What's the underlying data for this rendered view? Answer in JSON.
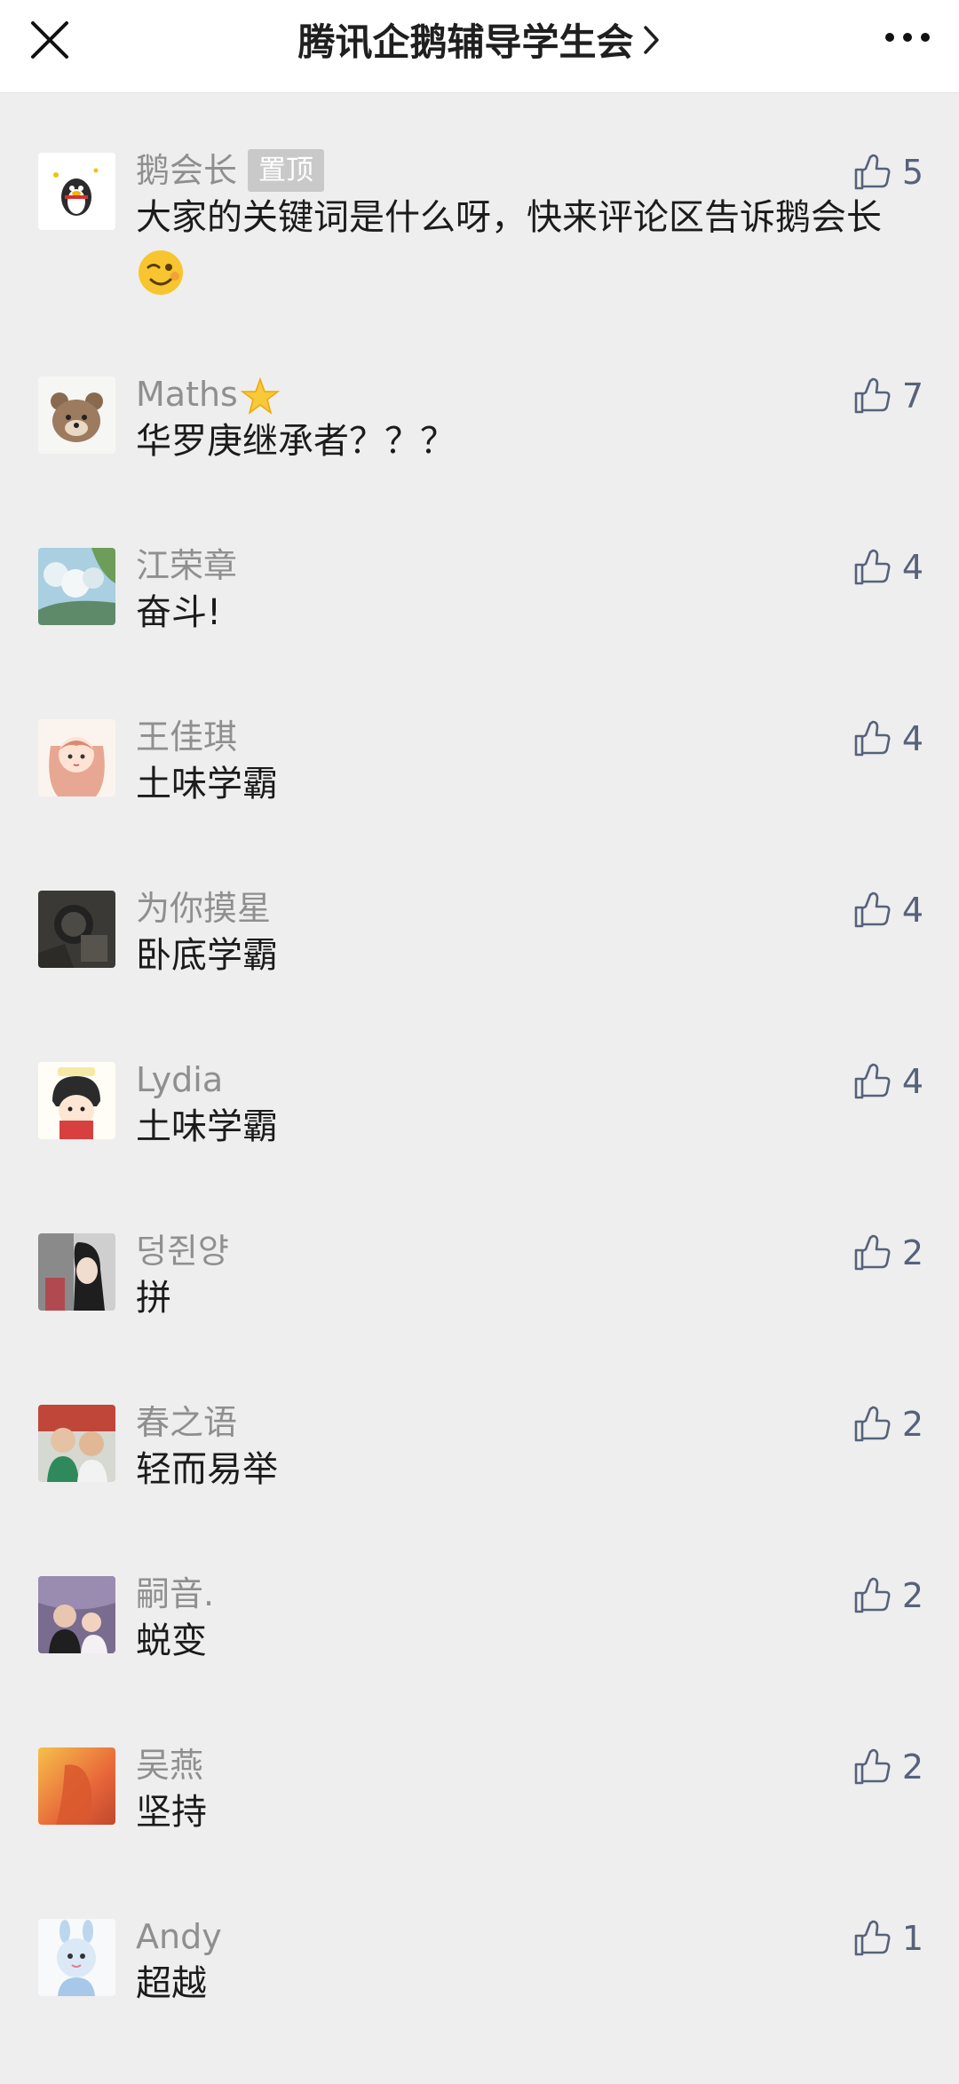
{
  "header": {
    "title": "腾讯企鹅辅导学生会",
    "close_icon": "close-icon",
    "more_icon": "more-icon"
  },
  "comments": [
    {
      "name": "鹅会长",
      "pinned_label": "置顶",
      "text": "大家的关键词是什么呀，快来评论区告诉鹅会长",
      "likes": "5"
    },
    {
      "name": "Maths",
      "text": "华罗庚继承者？？？",
      "likes": "7"
    },
    {
      "name": "江荣章",
      "text": "奋斗!",
      "likes": "4"
    },
    {
      "name": "王佳琪",
      "text": "土味学霸",
      "likes": "4"
    },
    {
      "name": "为你摸星",
      "text": "卧底学霸",
      "likes": "4"
    },
    {
      "name": "Lydia",
      "text": "土味学霸",
      "likes": "4"
    },
    {
      "name": "덩쥔양",
      "text": "拼",
      "likes": "2"
    },
    {
      "name": "春之语",
      "text": "轻而易举",
      "likes": "2"
    },
    {
      "name": "嗣音.",
      "text": "蜕变",
      "likes": "2"
    },
    {
      "name": "吴燕",
      "text": "坚持",
      "likes": "2"
    },
    {
      "name": "Andy",
      "text": "超越",
      "likes": "1"
    }
  ],
  "colors": {
    "background": "#eeeeee",
    "name": "#8f8f8f",
    "like": "#56627a",
    "pin_tag": "#c9c9c9"
  }
}
